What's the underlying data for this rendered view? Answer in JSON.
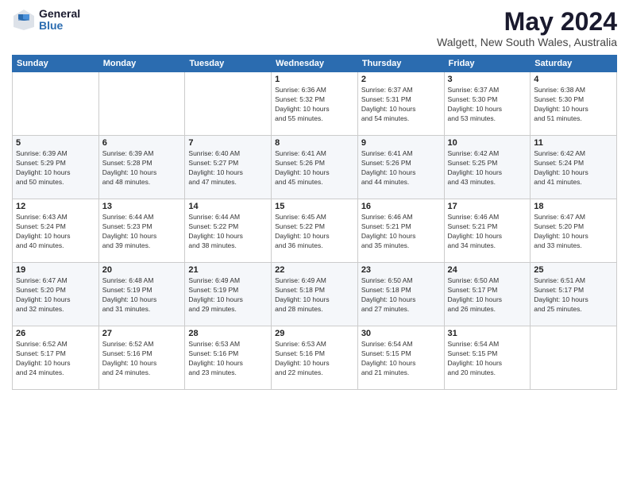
{
  "logo": {
    "general": "General",
    "blue": "Blue"
  },
  "title": "May 2024",
  "subtitle": "Walgett, New South Wales, Australia",
  "days_of_week": [
    "Sunday",
    "Monday",
    "Tuesday",
    "Wednesday",
    "Thursday",
    "Friday",
    "Saturday"
  ],
  "weeks": [
    [
      {
        "day": "",
        "info": ""
      },
      {
        "day": "",
        "info": ""
      },
      {
        "day": "",
        "info": ""
      },
      {
        "day": "1",
        "info": "Sunrise: 6:36 AM\nSunset: 5:32 PM\nDaylight: 10 hours\nand 55 minutes."
      },
      {
        "day": "2",
        "info": "Sunrise: 6:37 AM\nSunset: 5:31 PM\nDaylight: 10 hours\nand 54 minutes."
      },
      {
        "day": "3",
        "info": "Sunrise: 6:37 AM\nSunset: 5:30 PM\nDaylight: 10 hours\nand 53 minutes."
      },
      {
        "day": "4",
        "info": "Sunrise: 6:38 AM\nSunset: 5:30 PM\nDaylight: 10 hours\nand 51 minutes."
      }
    ],
    [
      {
        "day": "5",
        "info": "Sunrise: 6:39 AM\nSunset: 5:29 PM\nDaylight: 10 hours\nand 50 minutes."
      },
      {
        "day": "6",
        "info": "Sunrise: 6:39 AM\nSunset: 5:28 PM\nDaylight: 10 hours\nand 48 minutes."
      },
      {
        "day": "7",
        "info": "Sunrise: 6:40 AM\nSunset: 5:27 PM\nDaylight: 10 hours\nand 47 minutes."
      },
      {
        "day": "8",
        "info": "Sunrise: 6:41 AM\nSunset: 5:26 PM\nDaylight: 10 hours\nand 45 minutes."
      },
      {
        "day": "9",
        "info": "Sunrise: 6:41 AM\nSunset: 5:26 PM\nDaylight: 10 hours\nand 44 minutes."
      },
      {
        "day": "10",
        "info": "Sunrise: 6:42 AM\nSunset: 5:25 PM\nDaylight: 10 hours\nand 43 minutes."
      },
      {
        "day": "11",
        "info": "Sunrise: 6:42 AM\nSunset: 5:24 PM\nDaylight: 10 hours\nand 41 minutes."
      }
    ],
    [
      {
        "day": "12",
        "info": "Sunrise: 6:43 AM\nSunset: 5:24 PM\nDaylight: 10 hours\nand 40 minutes."
      },
      {
        "day": "13",
        "info": "Sunrise: 6:44 AM\nSunset: 5:23 PM\nDaylight: 10 hours\nand 39 minutes."
      },
      {
        "day": "14",
        "info": "Sunrise: 6:44 AM\nSunset: 5:22 PM\nDaylight: 10 hours\nand 38 minutes."
      },
      {
        "day": "15",
        "info": "Sunrise: 6:45 AM\nSunset: 5:22 PM\nDaylight: 10 hours\nand 36 minutes."
      },
      {
        "day": "16",
        "info": "Sunrise: 6:46 AM\nSunset: 5:21 PM\nDaylight: 10 hours\nand 35 minutes."
      },
      {
        "day": "17",
        "info": "Sunrise: 6:46 AM\nSunset: 5:21 PM\nDaylight: 10 hours\nand 34 minutes."
      },
      {
        "day": "18",
        "info": "Sunrise: 6:47 AM\nSunset: 5:20 PM\nDaylight: 10 hours\nand 33 minutes."
      }
    ],
    [
      {
        "day": "19",
        "info": "Sunrise: 6:47 AM\nSunset: 5:20 PM\nDaylight: 10 hours\nand 32 minutes."
      },
      {
        "day": "20",
        "info": "Sunrise: 6:48 AM\nSunset: 5:19 PM\nDaylight: 10 hours\nand 31 minutes."
      },
      {
        "day": "21",
        "info": "Sunrise: 6:49 AM\nSunset: 5:19 PM\nDaylight: 10 hours\nand 29 minutes."
      },
      {
        "day": "22",
        "info": "Sunrise: 6:49 AM\nSunset: 5:18 PM\nDaylight: 10 hours\nand 28 minutes."
      },
      {
        "day": "23",
        "info": "Sunrise: 6:50 AM\nSunset: 5:18 PM\nDaylight: 10 hours\nand 27 minutes."
      },
      {
        "day": "24",
        "info": "Sunrise: 6:50 AM\nSunset: 5:17 PM\nDaylight: 10 hours\nand 26 minutes."
      },
      {
        "day": "25",
        "info": "Sunrise: 6:51 AM\nSunset: 5:17 PM\nDaylight: 10 hours\nand 25 minutes."
      }
    ],
    [
      {
        "day": "26",
        "info": "Sunrise: 6:52 AM\nSunset: 5:17 PM\nDaylight: 10 hours\nand 24 minutes."
      },
      {
        "day": "27",
        "info": "Sunrise: 6:52 AM\nSunset: 5:16 PM\nDaylight: 10 hours\nand 24 minutes."
      },
      {
        "day": "28",
        "info": "Sunrise: 6:53 AM\nSunset: 5:16 PM\nDaylight: 10 hours\nand 23 minutes."
      },
      {
        "day": "29",
        "info": "Sunrise: 6:53 AM\nSunset: 5:16 PM\nDaylight: 10 hours\nand 22 minutes."
      },
      {
        "day": "30",
        "info": "Sunrise: 6:54 AM\nSunset: 5:15 PM\nDaylight: 10 hours\nand 21 minutes."
      },
      {
        "day": "31",
        "info": "Sunrise: 6:54 AM\nSunset: 5:15 PM\nDaylight: 10 hours\nand 20 minutes."
      },
      {
        "day": "",
        "info": ""
      }
    ]
  ]
}
